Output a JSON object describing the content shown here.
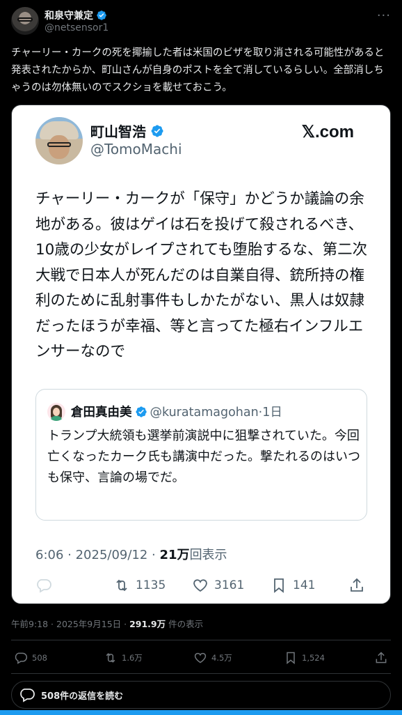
{
  "author": {
    "name": "和泉守兼定",
    "handle": "@netsensor1",
    "verified": true
  },
  "menu_icon": "ellipsis-icon",
  "tweet_text": "チャーリー・カークの死を揶揄した者は米国のビザを取り消される可能性があると発表されたからか、町山さんが自身のポストを全て消しているらしい。全部消しちゃうのは勿体無いのでスクショを載せておこう。",
  "screenshot": {
    "author_name": "町山智浩",
    "author_handle": "@TomoMachi",
    "brand": "𝕏.com",
    "body": "チャーリー・カークが「保守」かどうか議論の余地がある。彼はゲイは石を投げて殺されるべき、10歳の少女がレイプされても堕胎するな、第二次大戦で日本人が死んだのは自業自得、銃所持の権利のために乱射事件もしかたがない、黒人は奴隷だったほうが幸福、等と言ってた極右インフルエンサーなので",
    "quote": {
      "name": "倉田真由美",
      "handle_time": "@kuratamagohan·1日",
      "body": "トランプ大統領も選挙前演説中に狙撃されていた。今回亡くなったカーク氏も講演中だった。撃たれるのはいつも保守、言論の場でだ。"
    },
    "time": "6:06 · 2025/09/12 · ",
    "views_num": "21万",
    "views_label": "回表示",
    "actions": {
      "reply": "",
      "retweet": "1135",
      "like": "3161",
      "bookmark": "141"
    }
  },
  "meta": {
    "time": "午前9:18 · 2025年9月15日 · ",
    "views": "291.9万",
    "views_label": " 件の表示"
  },
  "actions": {
    "reply": "508",
    "retweet": "1.6万",
    "like": "4.5万",
    "bookmark": "1,524"
  },
  "read_replies": "508件の返信を読む",
  "colors": {
    "accent": "#1d9bf0",
    "background": "#000000",
    "text": "#e7e9ea",
    "muted": "#71767b"
  }
}
